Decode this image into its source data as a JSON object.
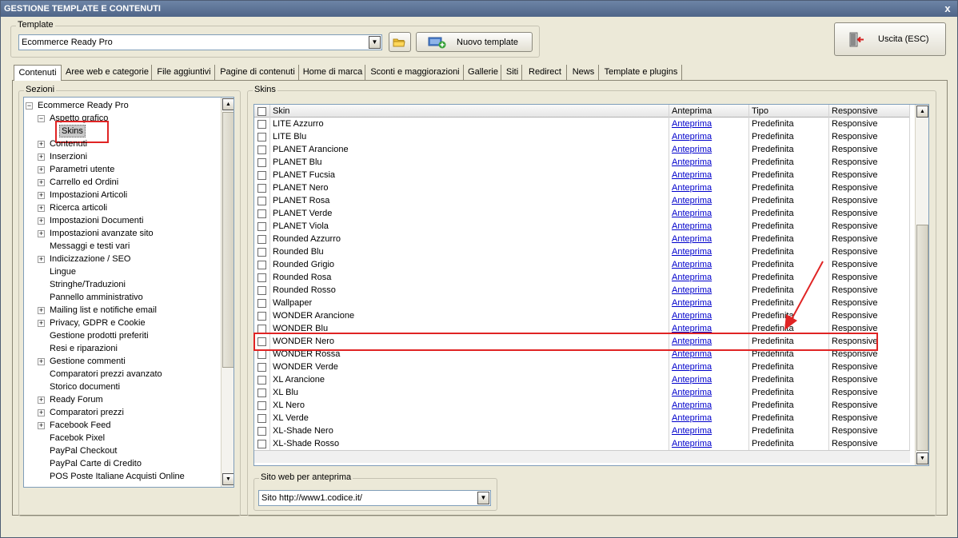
{
  "window": {
    "title": "GESTIONE TEMPLATE E CONTENUTI",
    "close": "x"
  },
  "template": {
    "group_label": "Template",
    "selected": "Ecommerce Ready Pro",
    "folder_icon": "folder-icon",
    "new_button": "Nuovo template"
  },
  "exit_button": "Uscita (ESC)",
  "tabs": [
    {
      "label": "Contenuti",
      "active": true
    },
    {
      "label": "Aree web e categorie"
    },
    {
      "label": "File aggiuntivi"
    },
    {
      "label": "Pagine di contenuti"
    },
    {
      "label": "Home di marca"
    },
    {
      "label": "Sconti e maggiorazioni"
    },
    {
      "label": "Gallerie"
    },
    {
      "label": "Siti"
    },
    {
      "label": "Redirect"
    },
    {
      "label": "News"
    },
    {
      "label": "Template e plugins"
    }
  ],
  "sections": {
    "label": "Sezioni",
    "root": "Ecommerce Ready Pro",
    "aspect": "Aspetto grafico",
    "selected_child": "Skins",
    "items": [
      {
        "label": "Contenuti",
        "expandable": true
      },
      {
        "label": "Inserzioni",
        "expandable": true
      },
      {
        "label": "Parametri utente",
        "expandable": true
      },
      {
        "label": "Carrello ed Ordini",
        "expandable": true
      },
      {
        "label": "Impostazioni Articoli",
        "expandable": true
      },
      {
        "label": "Ricerca articoli",
        "expandable": true
      },
      {
        "label": "Impostazioni Documenti",
        "expandable": true
      },
      {
        "label": "Impostazioni avanzate sito",
        "expandable": true
      },
      {
        "label": "Messaggi e testi vari",
        "expandable": false
      },
      {
        "label": "Indicizzazione / SEO",
        "expandable": true
      },
      {
        "label": "Lingue",
        "expandable": false
      },
      {
        "label": "Stringhe/Traduzioni",
        "expandable": false
      },
      {
        "label": "Pannello amministrativo",
        "expandable": false
      },
      {
        "label": "Mailing list e notifiche email",
        "expandable": true
      },
      {
        "label": "Privacy, GDPR e Cookie",
        "expandable": true
      },
      {
        "label": "Gestione prodotti preferiti",
        "expandable": false
      },
      {
        "label": "Resi e riparazioni",
        "expandable": false
      },
      {
        "label": "Gestione commenti",
        "expandable": true
      },
      {
        "label": "Comparatori prezzi avanzato",
        "expandable": false
      },
      {
        "label": "Storico documenti",
        "expandable": false
      },
      {
        "label": "Ready Forum",
        "expandable": true
      },
      {
        "label": "Comparatori prezzi",
        "expandable": true
      },
      {
        "label": "Facebook Feed",
        "expandable": true
      },
      {
        "label": "Facebok Pixel",
        "expandable": false
      },
      {
        "label": "PayPal Checkout",
        "expandable": false
      },
      {
        "label": "PayPal Carte di Credito",
        "expandable": false
      },
      {
        "label": "POS Poste Italiane Acquisti Online",
        "expandable": false
      }
    ]
  },
  "skins": {
    "label": "Skins",
    "columns": [
      "Skin",
      "Anteprima",
      "Tipo",
      "Responsive"
    ],
    "rows": [
      {
        "skin": "LITE Azzurro",
        "preview": "Anteprima",
        "type": "Predefinita",
        "responsive": "Responsive"
      },
      {
        "skin": "LITE Blu",
        "preview": "Anteprima",
        "type": "Predefinita",
        "responsive": "Responsive"
      },
      {
        "skin": "PLANET Arancione",
        "preview": "Anteprima",
        "type": "Predefinita",
        "responsive": "Responsive"
      },
      {
        "skin": "PLANET Blu",
        "preview": "Anteprima",
        "type": "Predefinita",
        "responsive": "Responsive"
      },
      {
        "skin": "PLANET Fucsia",
        "preview": "Anteprima",
        "type": "Predefinita",
        "responsive": "Responsive"
      },
      {
        "skin": "PLANET Nero",
        "preview": "Anteprima",
        "type": "Predefinita",
        "responsive": "Responsive"
      },
      {
        "skin": "PLANET Rosa",
        "preview": "Anteprima",
        "type": "Predefinita",
        "responsive": "Responsive"
      },
      {
        "skin": "PLANET Verde",
        "preview": "Anteprima",
        "type": "Predefinita",
        "responsive": "Responsive"
      },
      {
        "skin": "PLANET Viola",
        "preview": "Anteprima",
        "type": "Predefinita",
        "responsive": "Responsive"
      },
      {
        "skin": "Rounded Azzurro",
        "preview": "Anteprima",
        "type": "Predefinita",
        "responsive": "Responsive"
      },
      {
        "skin": "Rounded Blu",
        "preview": "Anteprima",
        "type": "Predefinita",
        "responsive": "Responsive"
      },
      {
        "skin": "Rounded Grigio",
        "preview": "Anteprima",
        "type": "Predefinita",
        "responsive": "Responsive"
      },
      {
        "skin": "Rounded Rosa",
        "preview": "Anteprima",
        "type": "Predefinita",
        "responsive": "Responsive"
      },
      {
        "skin": "Rounded Rosso",
        "preview": "Anteprima",
        "type": "Predefinita",
        "responsive": "Responsive"
      },
      {
        "skin": "Wallpaper",
        "preview": "Anteprima",
        "type": "Predefinita",
        "responsive": "Responsive"
      },
      {
        "skin": "WONDER Arancione",
        "preview": "Anteprima",
        "type": "Predefinita",
        "responsive": "Responsive"
      },
      {
        "skin": "WONDER Blu",
        "preview": "Anteprima",
        "type": "Predefinita",
        "responsive": "Responsive"
      },
      {
        "skin": "WONDER Nero",
        "preview": "Anteprima",
        "type": "Predefinita",
        "responsive": "Responsive",
        "highlighted": true
      },
      {
        "skin": "WONDER Rossa",
        "preview": "Anteprima",
        "type": "Predefinita",
        "responsive": "Responsive"
      },
      {
        "skin": "WONDER Verde",
        "preview": "Anteprima",
        "type": "Predefinita",
        "responsive": "Responsive"
      },
      {
        "skin": "XL Arancione",
        "preview": "Anteprima",
        "type": "Predefinita",
        "responsive": "Responsive"
      },
      {
        "skin": "XL Blu",
        "preview": "Anteprima",
        "type": "Predefinita",
        "responsive": "Responsive"
      },
      {
        "skin": "XL Nero",
        "preview": "Anteprima",
        "type": "Predefinita",
        "responsive": "Responsive"
      },
      {
        "skin": "XL Verde",
        "preview": "Anteprima",
        "type": "Predefinita",
        "responsive": "Responsive"
      },
      {
        "skin": "XL-Shade Nero",
        "preview": "Anteprima",
        "type": "Predefinita",
        "responsive": "Responsive"
      },
      {
        "skin": "XL-Shade Rosso",
        "preview": "Anteprima",
        "type": "Predefinita",
        "responsive": "Responsive"
      }
    ]
  },
  "preview_site": {
    "label": "Sito web per anteprima",
    "selected": "Sito http://www1.codice.it/"
  },
  "colors": {
    "highlight": "#e02424",
    "link": "#0000cc",
    "titlebar": "#5a7094"
  }
}
